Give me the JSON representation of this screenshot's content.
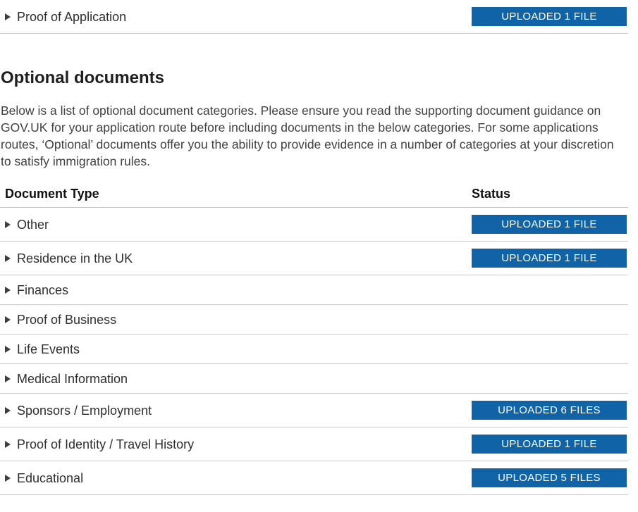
{
  "colors": {
    "badge_background": "#1163a7",
    "badge_text": "#ffffff",
    "divider": "#cbcbcb"
  },
  "pinned_row": {
    "label": "Proof of Application",
    "status": "UPLOADED 1 FILE"
  },
  "section": {
    "heading": "Optional documents",
    "intro": "Below is a list of optional document categories. Please ensure you read the supporting document guidance on GOV.UK for your application route before including documents in the below categories. For some applications routes, ‘Optional’ documents offer you the ability to provide evidence in a number of categories at your discretion to satisfy immigration rules."
  },
  "table": {
    "header": {
      "document_type": "Document Type",
      "status": "Status"
    },
    "rows": [
      {
        "label": "Other",
        "status": "UPLOADED 1 FILE"
      },
      {
        "label": "Residence in the UK",
        "status": "UPLOADED 1 FILE"
      },
      {
        "label": "Finances",
        "status": ""
      },
      {
        "label": "Proof of Business",
        "status": ""
      },
      {
        "label": "Life Events",
        "status": ""
      },
      {
        "label": "Medical Information",
        "status": ""
      },
      {
        "label": "Sponsors / Employment",
        "status": "UPLOADED 6 FILES"
      },
      {
        "label": "Proof of Identity / Travel History",
        "status": "UPLOADED 1 FILE"
      },
      {
        "label": "Educational",
        "status": "UPLOADED 5 FILES"
      }
    ]
  }
}
